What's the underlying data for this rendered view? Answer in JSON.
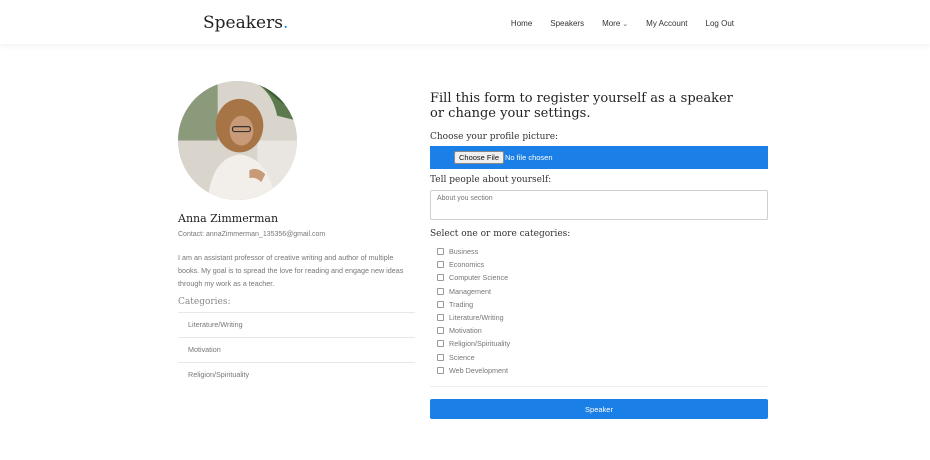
{
  "brand": {
    "name": "Speakers",
    "dot": "."
  },
  "nav": {
    "home": "Home",
    "speakers": "Speakers",
    "more": "More",
    "account": "My Account",
    "logout": "Log Out"
  },
  "profile": {
    "name": "Anna Zimmerman",
    "contact": "Contact: annaZimmerman_135356@gmail.com",
    "bio": "I am an assistant professor of creative writing and author of multiple books. My goal is to spread the love for reading and engage new ideas through my work as a teacher.",
    "categories_title": "Categories:",
    "categories": [
      "Literature/Writing",
      "Motivation",
      "Religion/Spirituality"
    ]
  },
  "form": {
    "title": "Fill this form to register yourself as a speaker or change your settings.",
    "picture_label": "Choose your profile picture:",
    "file_button": "Choose File",
    "file_status": "No file chosen",
    "about_label": "Tell people about yourself:",
    "about_placeholder": "About you section",
    "categories_label": "Select one or more categories:",
    "options": [
      "Business",
      "Economics",
      "Computer Science",
      "Management",
      "Trading",
      "Literature/Writing",
      "Motivation",
      "Religion/Spirituality",
      "Science",
      "Web Development"
    ],
    "submit": "Speaker"
  },
  "colors": {
    "accent": "#1a7fe6",
    "brand_dot": "#1e88e5"
  }
}
